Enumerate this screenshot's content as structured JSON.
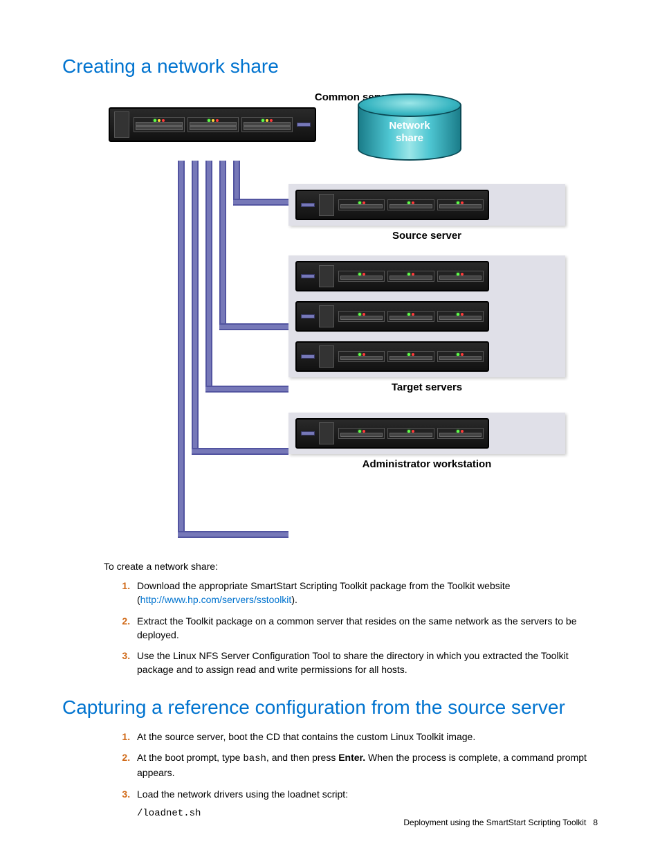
{
  "section1": {
    "title": "Creating a network share",
    "diagram": {
      "common_label": "Common server",
      "network_share_label": "Network\nshare",
      "source_label": "Source server",
      "target_label": "Target servers",
      "admin_label": "Administrator workstation"
    },
    "intro": "To create a network share:",
    "steps": [
      {
        "pre": "Download the appropriate SmartStart Scripting Toolkit package from the Toolkit website (",
        "link": "http://www.hp.com/servers/sstoolkit",
        "post": ")."
      },
      {
        "text": "Extract the Toolkit package on a common server that resides on the same network as the servers to be deployed."
      },
      {
        "text": "Use the Linux NFS Server Configuration Tool to share the directory in which you extracted the Toolkit package and to assign read and write permissions for all hosts."
      }
    ]
  },
  "section2": {
    "title": "Capturing a reference configuration from the source server",
    "steps": [
      {
        "text": "At the source server, boot the CD that contains the custom Linux Toolkit image."
      },
      {
        "pre": "At the boot prompt, type ",
        "code": "bash",
        "mid": ",  and then press ",
        "bold": "Enter.",
        "post": " When the process is complete, a command prompt appears."
      },
      {
        "text": "Load the network drivers using the loadnet script:"
      }
    ],
    "code_line": "/loadnet.sh"
  },
  "footer": {
    "text": "Deployment using the SmartStart Scripting Toolkit",
    "page": "8"
  }
}
